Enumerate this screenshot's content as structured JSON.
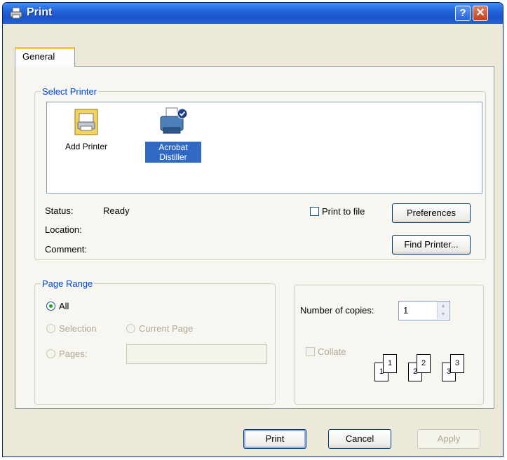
{
  "window": {
    "title": "Print",
    "help": "?",
    "close": "✕"
  },
  "tabs": [
    {
      "label": "General"
    }
  ],
  "select_printer": {
    "legend": "Select Printer",
    "printers": [
      {
        "label": "Add Printer",
        "icon": "add-printer-icon",
        "selected": false
      },
      {
        "label": "Acrobat Distiller",
        "icon": "printer-icon",
        "selected": true
      }
    ],
    "status_label": "Status:",
    "status_value": "Ready",
    "location_label": "Location:",
    "comment_label": "Comment:",
    "print_to_file_label": "Print to file",
    "print_to_file_checked": false,
    "preferences_button": "Preferences",
    "find_printer_button": "Find Printer..."
  },
  "page_range": {
    "legend": "Page Range",
    "all": "All",
    "selection": "Selection",
    "current_page": "Current Page",
    "pages": "Pages:",
    "selected_option": "All",
    "pages_value": ""
  },
  "copies": {
    "label": "Number of copies:",
    "value": "1",
    "collate_label": "Collate",
    "collate_checked": false,
    "collate_pages": [
      "1",
      "1",
      "2",
      "2",
      "3",
      "3"
    ]
  },
  "footer": {
    "print": "Print",
    "cancel": "Cancel",
    "apply": "Apply"
  },
  "colors": {
    "accent": "#0046d5",
    "titlebar": "#1f5fd7",
    "selection": "#316ac5"
  }
}
